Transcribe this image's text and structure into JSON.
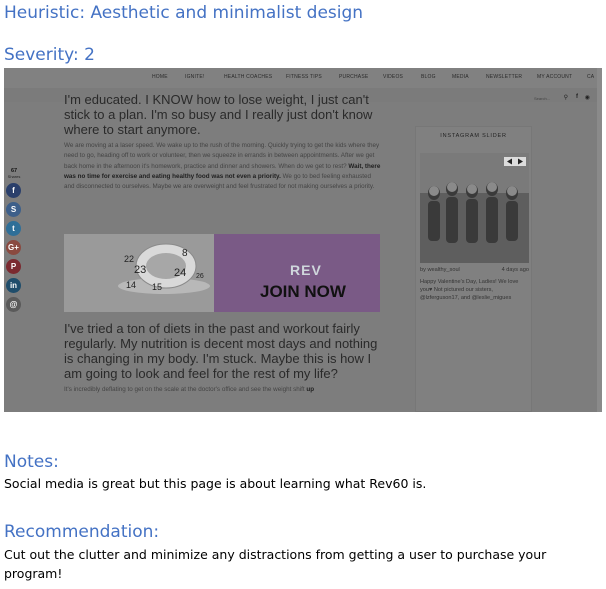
{
  "heuristic": "Heuristic: Aesthetic and minimalist design",
  "severity": "Severity: 2",
  "screenshot": {
    "nav": [
      "HOME",
      "IGNITE!",
      "HEALTH COACHES",
      "FITNESS TIPS",
      "PURCHASE",
      "VIDEOS",
      "BLOG",
      "MEDIA",
      "NEWSLETTER",
      "MY ACCOUNT",
      "CA"
    ],
    "search_placeholder": "Search...",
    "article": {
      "line1": "I'm educated. I KNOW how to lose weight, I just can't",
      "line2": "stick to a plan. I'm so busy and I really just don't know",
      "line3": "where to start anymore.",
      "para1_a": "We are moving at a laser speed. We wake up to the rush of the morning. Quickly trying to get the kids where they need to go, heading off to work or volunteer, then we squeeze in errands in between appointments. After we get back home in the afternoon it's homework, practice and dinner and showers. When do we get to rest? ",
      "para1_bold": "Wait, there was no time for exercise and eating healthy food was not even a priority.",
      "para1_b": " We go to bed feeling exhausted and disconnected to ourselves. Maybe we are overweight and feel frustrated for not making ourselves a priority.",
      "para2": "I've tried a ton of diets in the past and workout fairly regularly. My nutrition is decent most days and nothing is changing in my body. I'm stuck. Maybe this is how I am going to look and feel for the rest of my life?",
      "para3_a": "It's incredibly deflating to get on the scale at the doctor's office and see the weight shift ",
      "para3_bold": "up"
    },
    "banner": {
      "brand": "REV",
      "cta": "JOIN NOW",
      "tape_numbers": [
        "8",
        "23",
        "24",
        "14",
        "15",
        "26",
        "22"
      ]
    },
    "share": {
      "count": "67",
      "label": "Shares",
      "buttons": [
        "f",
        "S",
        "t",
        "G+",
        "P",
        "in",
        "@"
      ]
    },
    "instagram": {
      "title": "INSTAGRAM SLIDER",
      "user": "by wealthy_soul",
      "time": "4 days ago",
      "caption": "Happy Valentine's Day, Ladies! We love you♥ Not pictured our sisters, @lzferguson17, and @leslie_migues"
    },
    "colors": {
      "facebook": "#3b5998",
      "stumble": "#1a6fb6",
      "twitter": "#1da1f2",
      "google": "#dd4b39",
      "pinterest": "#cb2027",
      "linkedin": "#0077b5",
      "email": "#888888"
    }
  },
  "notes_heading": "Notes:",
  "notes_text": "Social media is great but this page is about learning what Rev60 is.",
  "recommendation_heading": "Recommendation:",
  "recommendation_line1": "Cut out the clutter and minimize any distractions from getting a user to purchase your",
  "recommendation_line2": "program!"
}
